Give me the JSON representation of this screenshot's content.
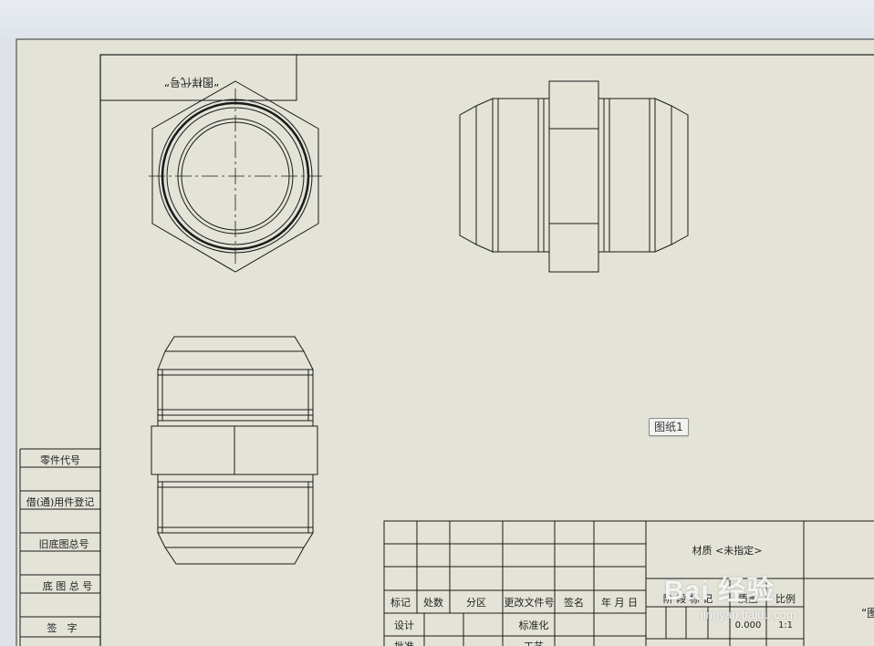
{
  "sheet": {
    "tab_label": "图纸1",
    "view_label_upside_down": "“图样代号”",
    "right_edge_label": "“图"
  },
  "side_block": {
    "rows": [
      "零件代号",
      "借(通)用件登记",
      "旧底图总号",
      "底 图 总 号",
      "签　字"
    ]
  },
  "title_block": {
    "headers": [
      "标记",
      "处数",
      "分区",
      "更改文件号",
      "签名",
      "年 月 日"
    ],
    "design_row": [
      "设计",
      "标准化"
    ],
    "bottom_row_partial": [
      "批准",
      "工艺"
    ],
    "material": "材质 <未指定>",
    "stage_headers": [
      "阶 段 标 记",
      "质量",
      "比例"
    ],
    "stage_values": [
      "0.000",
      "1:1"
    ]
  },
  "watermark": {
    "text": "Bai 经验",
    "url": "jingyan.baidu.com"
  },
  "colors": {
    "paper": "#e4e3d8",
    "line": "#1a1a1a"
  }
}
